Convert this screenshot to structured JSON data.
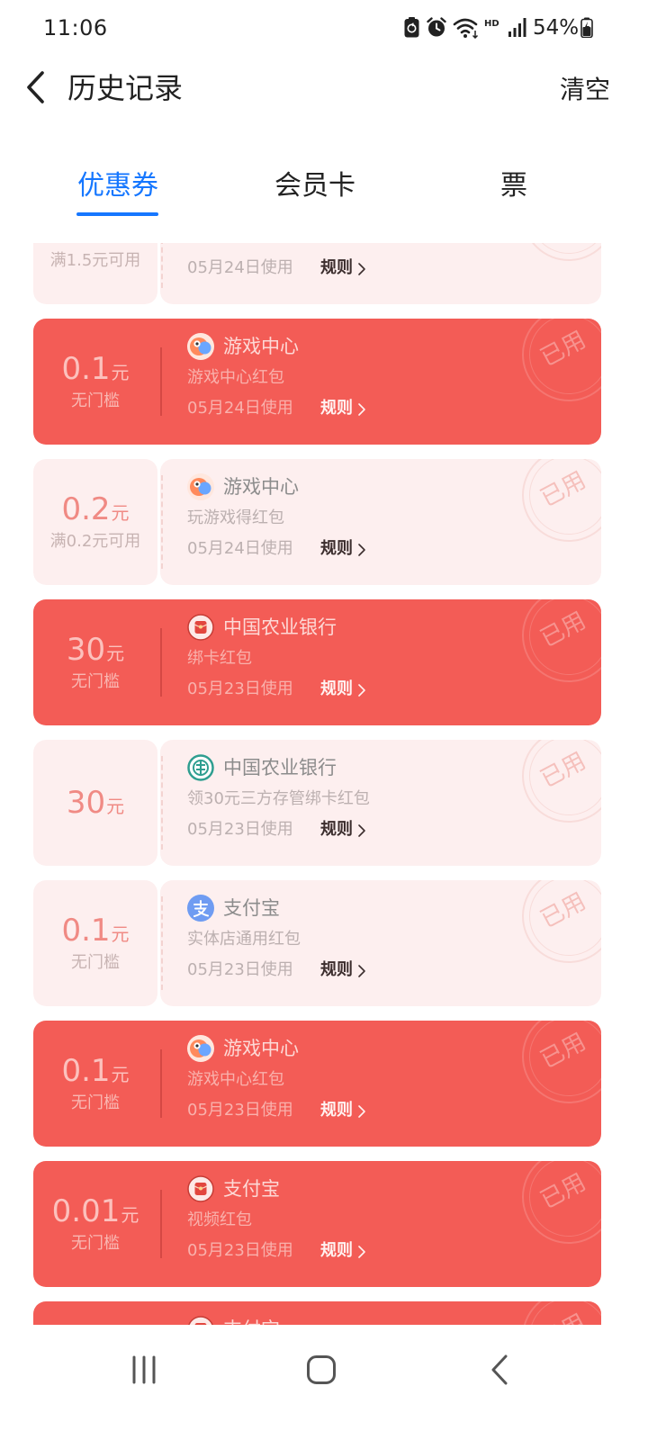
{
  "status_bar": {
    "time": "11:06",
    "network_label": "HD",
    "battery_percent": "54%",
    "icons": [
      "battery-saver-icon",
      "alarm-icon",
      "wifi-icon",
      "signal-icon",
      "battery-icon"
    ]
  },
  "header": {
    "back_icon": "chevron-left-icon",
    "title": "历史记录",
    "clear_label": "清空"
  },
  "tabs": [
    {
      "label": "优惠券",
      "active": true
    },
    {
      "label": "会员卡",
      "active": false
    },
    {
      "label": "票",
      "active": false
    }
  ],
  "theme": {
    "accent": "#1677ff",
    "red_card": "#f35c56",
    "light_card": "#fdefef",
    "amount_light": "#f08a84"
  },
  "coupons": [
    {
      "highlighted": false,
      "condition": "满1.5元可用",
      "used_date": "05月24日使用",
      "rules_label": "规则"
    },
    {
      "highlighted": true,
      "amount": "0.1",
      "unit": "元",
      "condition": "无门槛",
      "icon": "game-center-icon",
      "merchant": "游戏中心",
      "name": "游戏中心红包",
      "used_date": "05月24日使用",
      "rules_label": "规则",
      "stamp": "已用"
    },
    {
      "highlighted": false,
      "amount": "0.2",
      "unit": "元",
      "condition": "满0.2元可用",
      "icon": "game-center-icon",
      "merchant": "游戏中心",
      "name": "玩游戏得红包",
      "used_date": "05月24日使用",
      "rules_label": "规则",
      "stamp": "已用"
    },
    {
      "highlighted": true,
      "amount": "30",
      "unit": "元",
      "condition": "无门槛",
      "icon": "red-envelope-icon",
      "merchant": "中国农业银行",
      "name": "绑卡红包",
      "used_date": "05月23日使用",
      "rules_label": "规则",
      "stamp": "已用"
    },
    {
      "highlighted": false,
      "amount": "30",
      "unit": "元",
      "icon": "abc-bank-icon",
      "merchant": "中国农业银行",
      "name": "领30元三方存管绑卡红包",
      "used_date": "05月23日使用",
      "rules_label": "规则",
      "stamp": "已用"
    },
    {
      "highlighted": false,
      "amount": "0.1",
      "unit": "元",
      "condition": "无门槛",
      "icon": "alipay-icon",
      "merchant": "支付宝",
      "name": "实体店通用红包",
      "used_date": "05月23日使用",
      "rules_label": "规则",
      "stamp": "已用"
    },
    {
      "highlighted": true,
      "amount": "0.1",
      "unit": "元",
      "condition": "无门槛",
      "icon": "game-center-icon",
      "merchant": "游戏中心",
      "name": "游戏中心红包",
      "used_date": "05月23日使用",
      "rules_label": "规则",
      "stamp": "已用"
    },
    {
      "highlighted": true,
      "amount": "0.01",
      "unit": "元",
      "condition": "无门槛",
      "icon": "red-envelope-icon",
      "merchant": "支付宝",
      "name": "视频红包",
      "used_date": "05月23日使用",
      "rules_label": "规则",
      "stamp": "已用"
    },
    {
      "highlighted": true,
      "icon": "red-envelope-icon",
      "merchant": "支付宝",
      "stamp": "已用"
    }
  ],
  "nav_bar": {
    "icons": [
      "recent-apps-icon",
      "home-icon",
      "back-icon"
    ]
  }
}
